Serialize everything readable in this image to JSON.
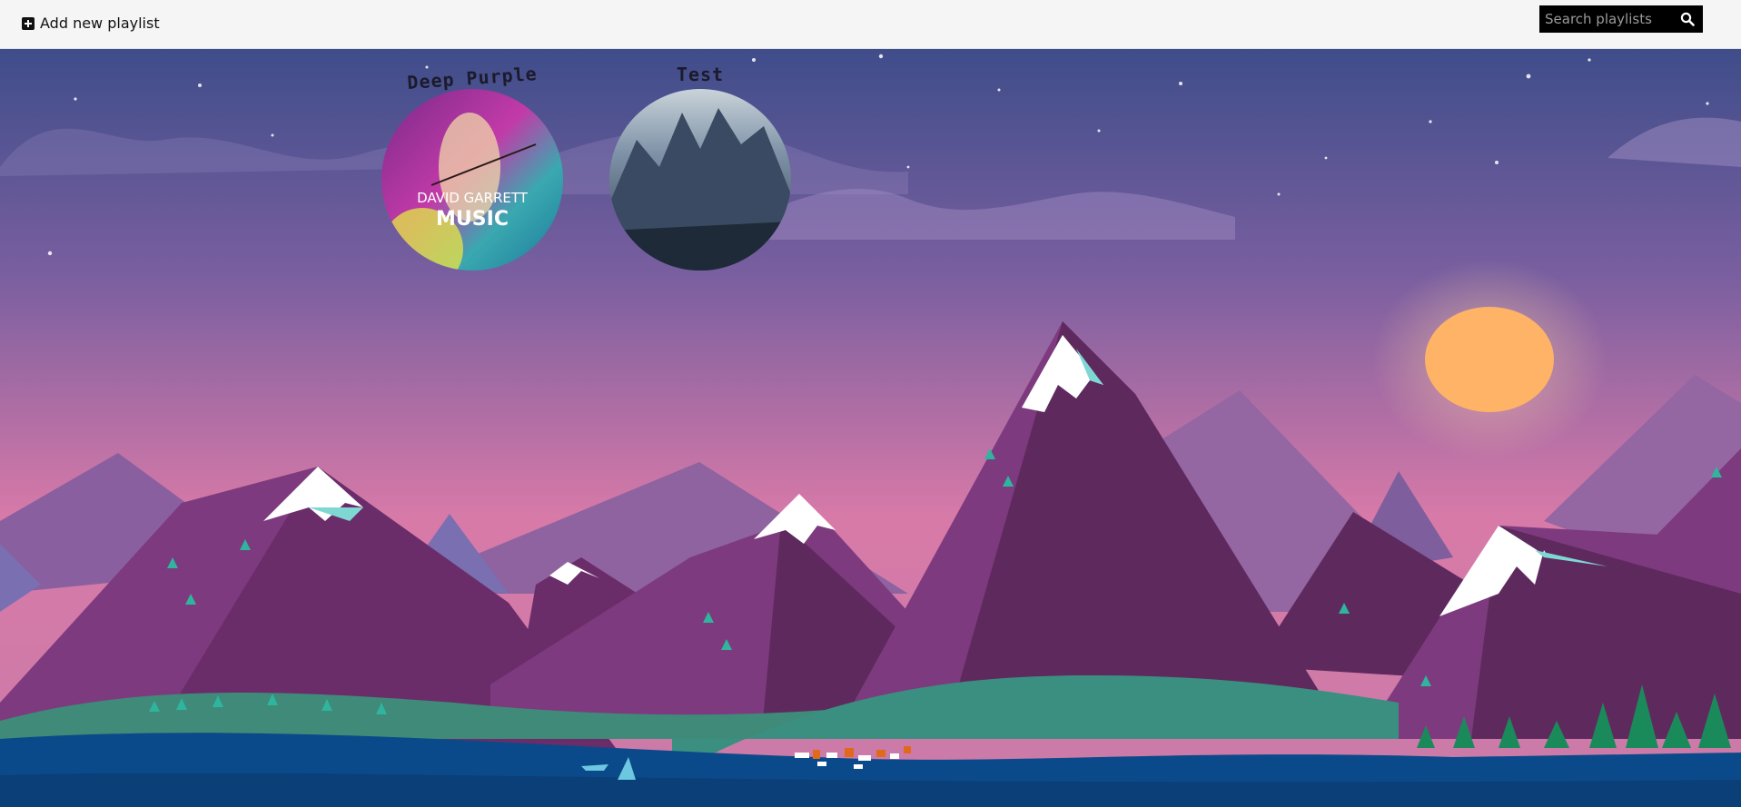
{
  "toolbar": {
    "add_label": "Add new playlist",
    "add_icon": "plus-square-icon",
    "search_placeholder": "Search playlists",
    "search_icon": "search-icon"
  },
  "playlists": [
    {
      "title": "Deep Purple",
      "cover_line1": "DAVID GARRETT",
      "cover_line2": "MUSIC"
    },
    {
      "title": "Test"
    }
  ],
  "colors": {
    "topbar_bg": "#f5f5f5",
    "search_bg": "#000000",
    "sky_top": "#3f4d8a",
    "sky_bottom": "#d87aa8",
    "sun": "#ffb366"
  }
}
